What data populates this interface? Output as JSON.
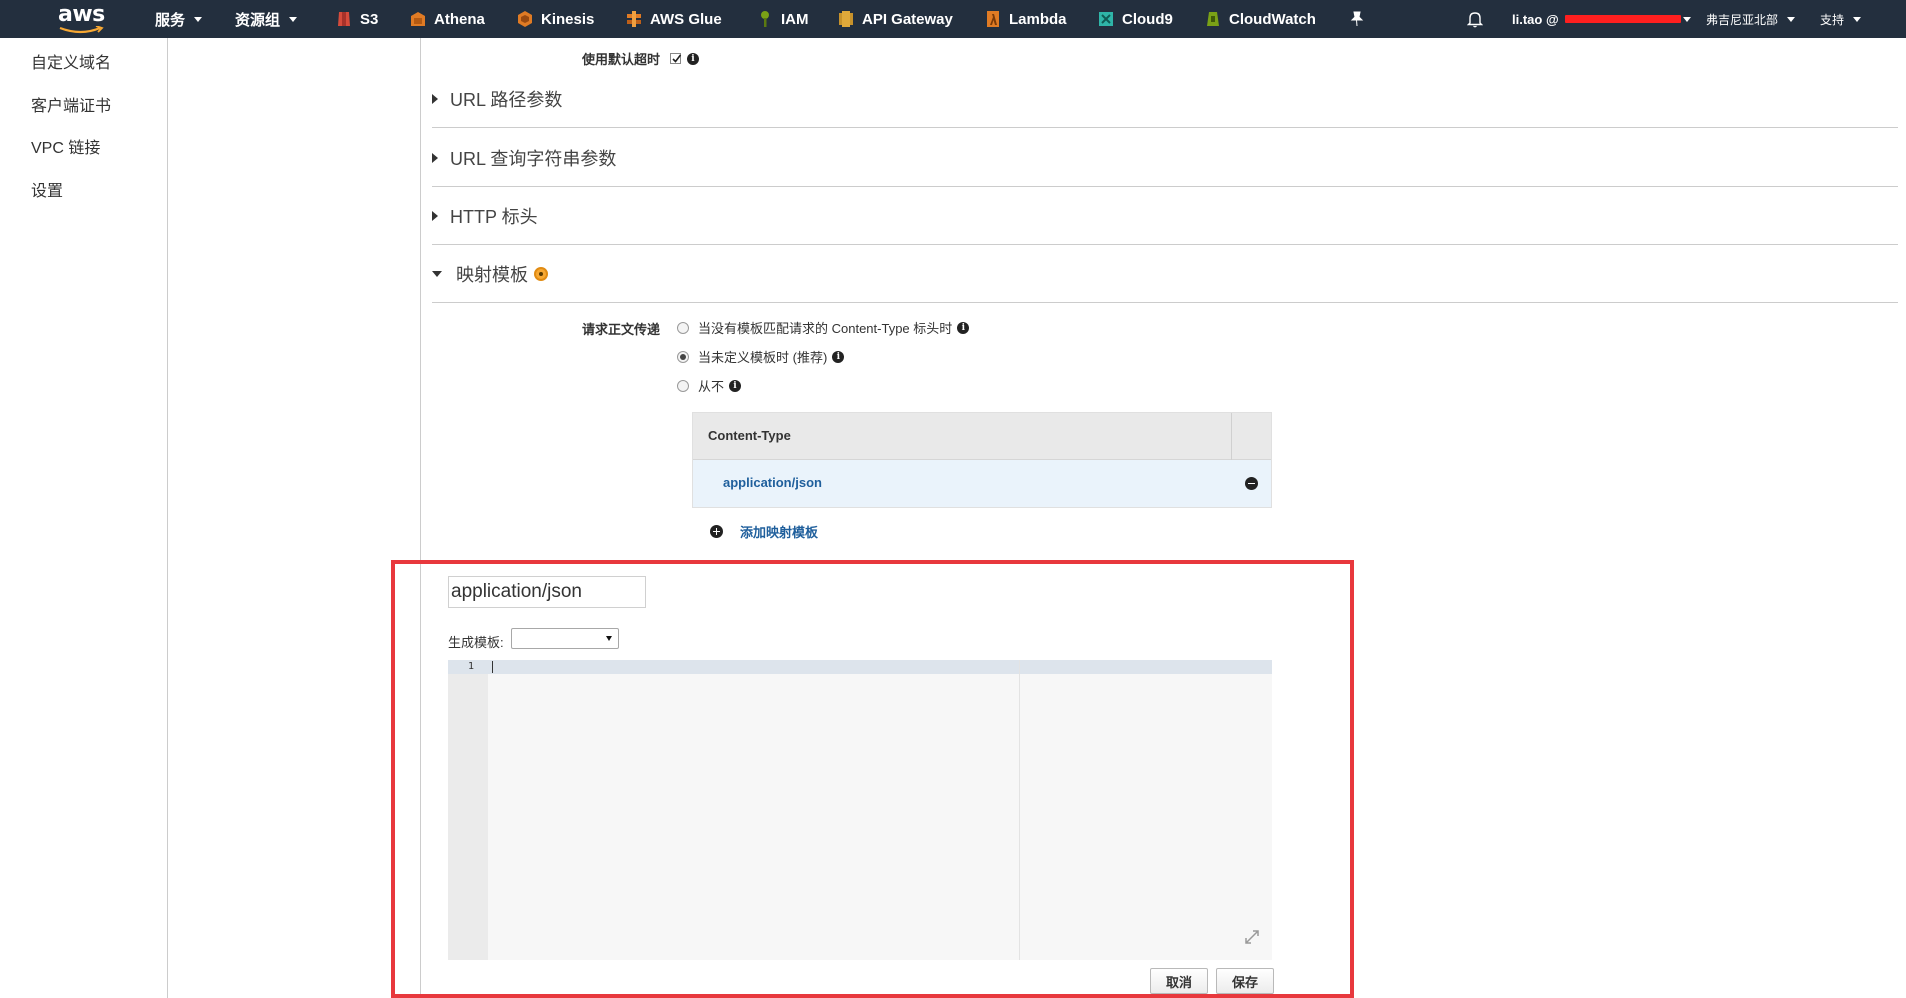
{
  "topnav": {
    "logo": "aws",
    "services": "服务",
    "resource_groups": "资源组",
    "pins": [
      "S3",
      "Athena",
      "Kinesis",
      "AWS Glue",
      "IAM",
      "API Gateway",
      "Lambda",
      "Cloud9",
      "CloudWatch"
    ],
    "user": "li.tao @",
    "region": "弗吉尼亚北部",
    "support": "支持"
  },
  "sidebar": {
    "items": [
      "自定义域名",
      "客户端证书",
      "VPC 链接",
      "设置"
    ]
  },
  "main": {
    "default_timeout_label": "使用默认超时",
    "sections": {
      "url_path_params": "URL 路径参数",
      "url_query_params": "URL 查询字符串参数",
      "http_headers": "HTTP 标头",
      "mapping_templates": "映射模板"
    },
    "passthrough": {
      "label": "请求正文传递",
      "options": [
        {
          "label": "当没有模板匹配请求的 Content-Type 标头时",
          "selected": false
        },
        {
          "label": "当未定义模板时 (推荐)",
          "selected": true
        },
        {
          "label": "从不",
          "selected": false
        }
      ]
    },
    "content_type_table": {
      "header": "Content-Type",
      "rows": [
        "application/json"
      ]
    },
    "add_template": "添加映射模板",
    "editor": {
      "content_type_value": "application/json",
      "generate_template_label": "生成模板:",
      "generate_template_selected": "",
      "line_numbers": [
        "1"
      ],
      "cancel": "取消",
      "save": "保存"
    }
  },
  "colors": {
    "nav_bg": "#232f3e",
    "link_blue": "#1f5f9c",
    "highlight_red": "#e8383d",
    "selected_row": "#eaf3fb"
  }
}
